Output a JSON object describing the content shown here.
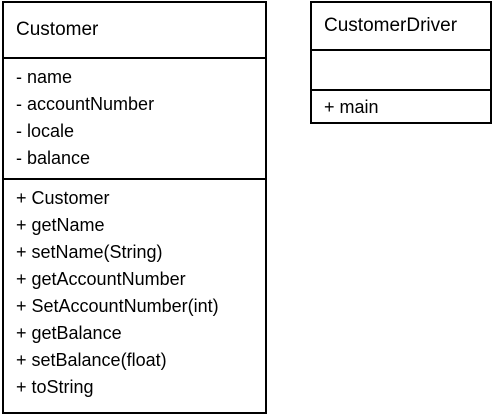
{
  "classes": [
    {
      "name": "Customer",
      "attributes": [
        "- name",
        "- accountNumber",
        "- locale",
        "- balance"
      ],
      "operations": [
        "+ Customer",
        "+ getName",
        "+ setName(String)",
        "+ getAccountNumber",
        "+ SetAccountNumber(int)",
        "+ getBalance",
        "+ setBalance(float)",
        "+ toString"
      ]
    },
    {
      "name": "CustomerDriver",
      "attributes": [],
      "operations": [
        "+ main"
      ]
    }
  ]
}
